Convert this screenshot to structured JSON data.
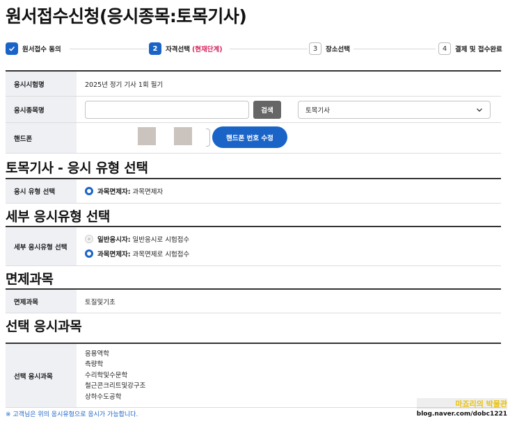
{
  "page": {
    "title": "원서접수신청(응시종목:토목기사)"
  },
  "steps": [
    {
      "num": "",
      "label": "원서접수 동의",
      "state": "done"
    },
    {
      "num": "2",
      "label": "자격선택",
      "current_tag": "(현재단계)",
      "state": "current"
    },
    {
      "num": "3",
      "label": "장소선택",
      "state": "todo"
    },
    {
      "num": "4",
      "label": "결제 및 접수완료",
      "state": "todo"
    }
  ],
  "exam_info": {
    "exam_name_label": "응시시험명",
    "exam_name_value": "2025년 정기 기사 1회 필기",
    "category_label": "응시종목명",
    "search_value": "",
    "search_button": "검색",
    "select_value": "토목기사",
    "phone_label": "핸드폰",
    "phone_button": "핸드폰 번호 수정"
  },
  "section_type": {
    "title": "토목기사 - 응시 유형 선택",
    "label": "응시 유형 선택",
    "option_bold": "과목면제자:",
    "option_text": "과목면제자"
  },
  "section_detail": {
    "title": "세부 응시유형 선택",
    "label": "세부 응시유형 선택",
    "options": [
      {
        "bold": "일반응시자:",
        "text": "일반응시로 시험접수",
        "selected": false
      },
      {
        "bold": "과목면제자:",
        "text": "과목면제로 시험접수",
        "selected": true
      }
    ]
  },
  "section_exempt": {
    "title": "면제과목",
    "label": "면제과목",
    "value": "토질및기초"
  },
  "section_subjects": {
    "title": "선택 응시과목",
    "label": "선택 응시과목",
    "subjects": [
      "응용역학",
      "측량학",
      "수리학및수문학",
      "철근콘크리트및강구조",
      "상하수도공학"
    ]
  },
  "notice": "※ 고객님은 위의 응시유형으로 응시가 가능합니다.",
  "watermark": {
    "line1": "마죠리의 박물관",
    "line2": "blog.naver.com/dobc1221"
  },
  "colors": {
    "primary": "#1a64c8",
    "accent": "#d6245c",
    "header_bg": "#eef0f4"
  }
}
